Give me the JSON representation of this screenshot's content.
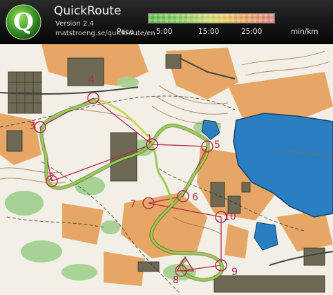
{
  "app": {
    "title": "QuickRoute",
    "version": "Version 2.4",
    "url": "matstroeng.se/quickroute/en",
    "logo_letter": "Q"
  },
  "pace_legend": {
    "label": "Pace",
    "ticks": [
      "5:00",
      "15:00",
      "25:00"
    ],
    "unit": "min/km",
    "gradient_colors": [
      "#58b947",
      "#8ccd5b",
      "#c9d86a",
      "#e8cf5b",
      "#e8a35a",
      "#e07b7e"
    ]
  },
  "map": {
    "control_labels": [
      "1",
      "2",
      "3",
      "4",
      "5",
      "6",
      "7",
      "8",
      "9",
      "10"
    ],
    "colors": {
      "lake": "#2a7fc2",
      "open_land": "#e8a868",
      "forest": "#f4f1e8",
      "green": "#9fcf8c",
      "building": "#6e6a56",
      "course": "#b5284a",
      "route": "#97c24a"
    }
  }
}
